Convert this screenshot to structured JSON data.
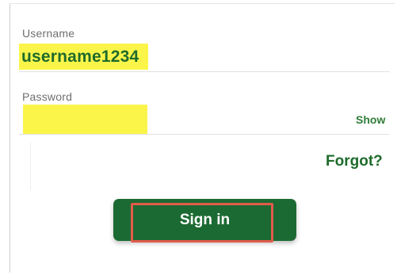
{
  "login_form": {
    "username": {
      "label": "Username",
      "value": "username1234"
    },
    "password": {
      "label": "Password",
      "value": "",
      "show_label": "Show"
    },
    "forgot_label": "Forgot?",
    "sign_in_label": "Sign in"
  },
  "colors": {
    "brand_green": "#1c6a33",
    "link_green": "#2f7d37",
    "highlight_yellow": "#fbf54a",
    "annotation_red": "#e25b4a"
  }
}
